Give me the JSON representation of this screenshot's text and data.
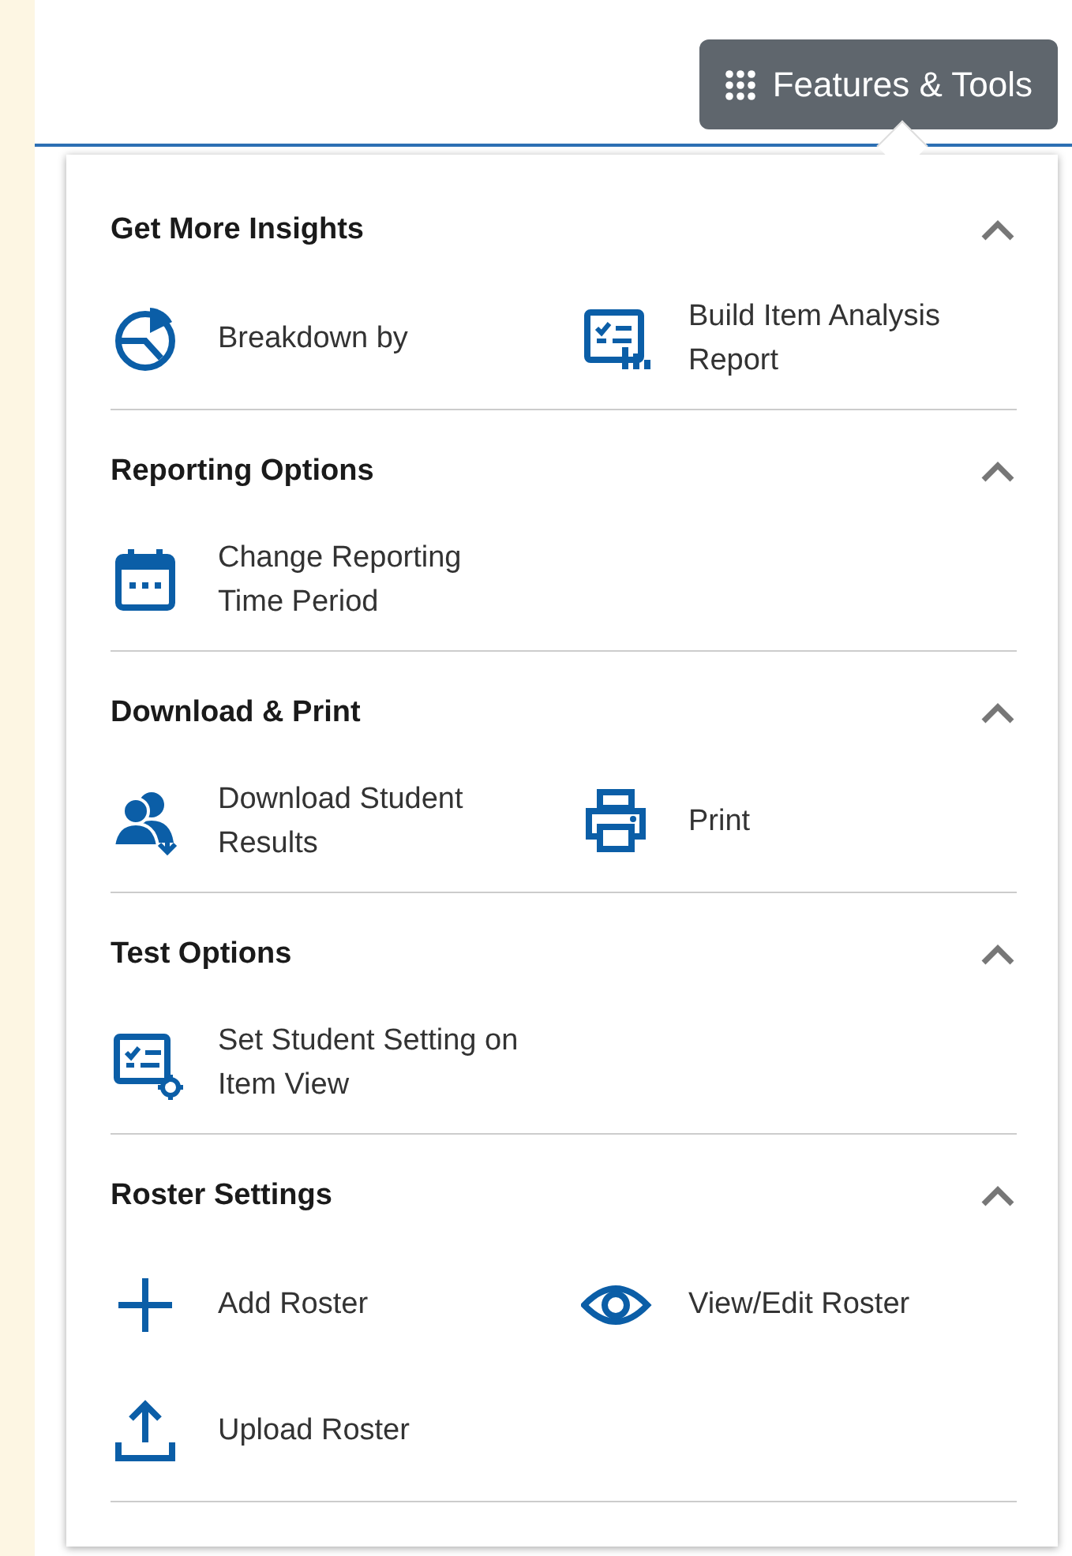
{
  "toolbar_button": {
    "label": "Features & Tools"
  },
  "sections": [
    {
      "title": "Get More Insights",
      "expanded": true,
      "items": [
        {
          "kind": "pie",
          "label": "Breakdown by"
        },
        {
          "kind": "report",
          "label": "Build Item Analysis Report"
        }
      ]
    },
    {
      "title": "Reporting Options",
      "expanded": true,
      "items": [
        {
          "kind": "calendar",
          "label": "Change Reporting Time Period"
        }
      ]
    },
    {
      "title": "Download & Print",
      "expanded": true,
      "items": [
        {
          "kind": "people",
          "label": "Download Student Results"
        },
        {
          "kind": "printer",
          "label": "Print"
        }
      ]
    },
    {
      "title": "Test Options",
      "expanded": true,
      "items": [
        {
          "kind": "checklist",
          "label": "Set Student Setting on Item View"
        }
      ]
    },
    {
      "title": "Roster Settings",
      "expanded": true,
      "items": [
        {
          "kind": "plus",
          "label": "Add Roster"
        },
        {
          "kind": "eye",
          "label": "View/Edit Roster"
        },
        {
          "kind": "upload",
          "label": "Upload Roster"
        }
      ]
    }
  ]
}
